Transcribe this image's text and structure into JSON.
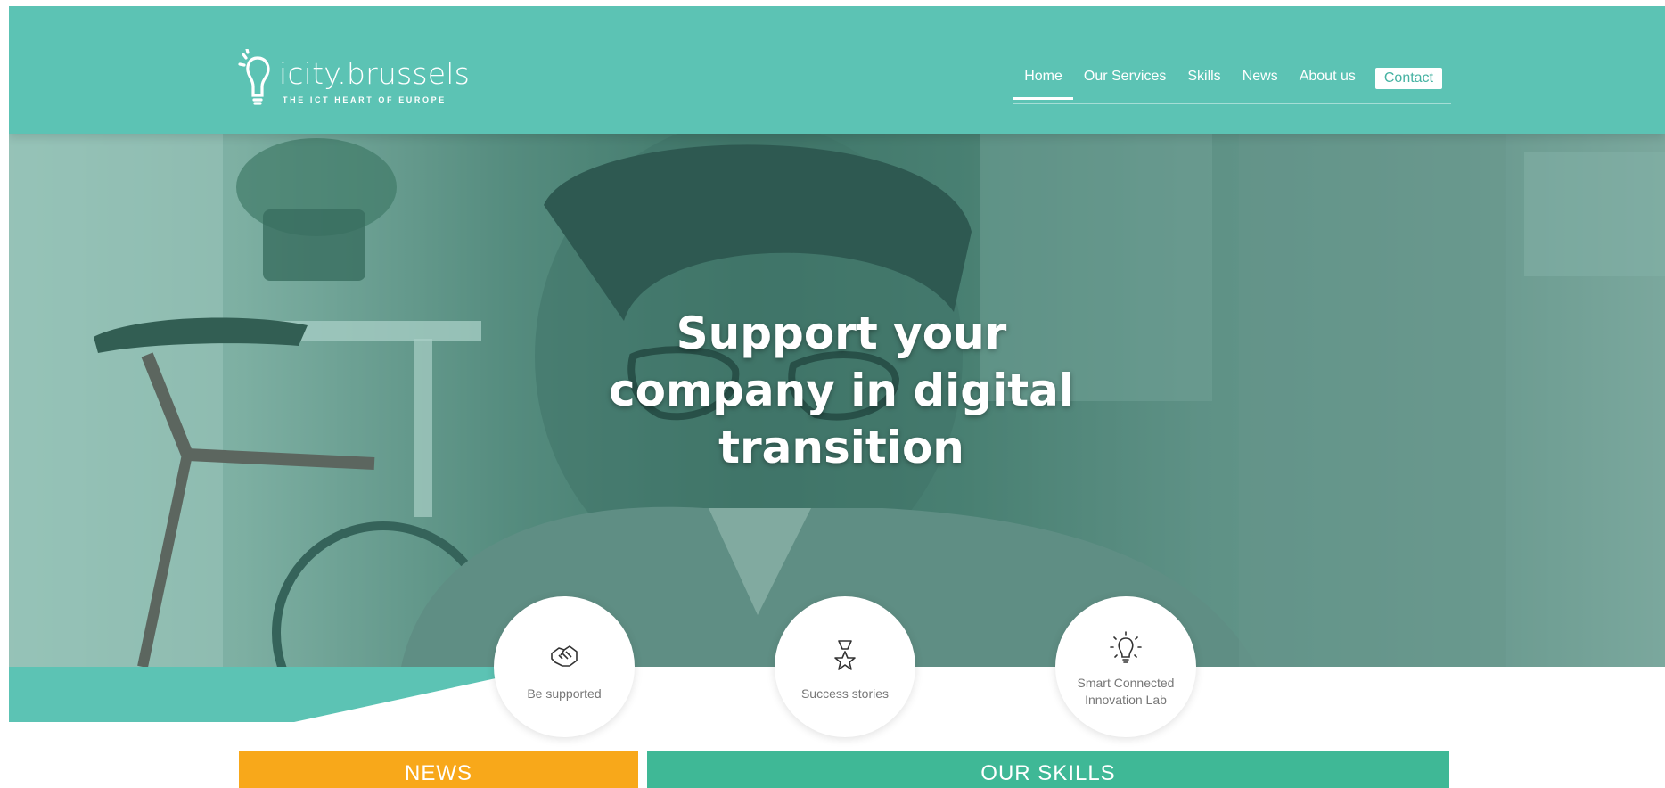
{
  "brand": {
    "name": "icity.brussels",
    "tagline": "THE ICT HEART OF EUROPE"
  },
  "nav": {
    "items": [
      {
        "label": "Home",
        "active": true
      },
      {
        "label": "Our Services",
        "active": false
      },
      {
        "label": "Skills",
        "active": false
      },
      {
        "label": "News",
        "active": false
      },
      {
        "label": "About us",
        "active": false
      }
    ],
    "contact_label": "Contact"
  },
  "hero": {
    "title": "Support your company in digital transition",
    "title_lines": [
      "Support your",
      "company in digital",
      "transition"
    ]
  },
  "features": [
    {
      "label": "Be supported",
      "icon": "handshake-icon"
    },
    {
      "label": "Success stories",
      "icon": "award-star-icon"
    },
    {
      "label": "Smart Connected Innovation Lab",
      "label_lines": [
        "Smart Connected",
        "Innovation Lab"
      ],
      "icon": "lightbulb-icon"
    }
  ],
  "tabs": {
    "news": "NEWS",
    "skills": "OUR SKILLS"
  },
  "colors": {
    "header_teal": "#5cc3b4",
    "news_orange": "#f8a81a",
    "skills_green": "#3fb896",
    "contact_text": "#45b2a2"
  }
}
